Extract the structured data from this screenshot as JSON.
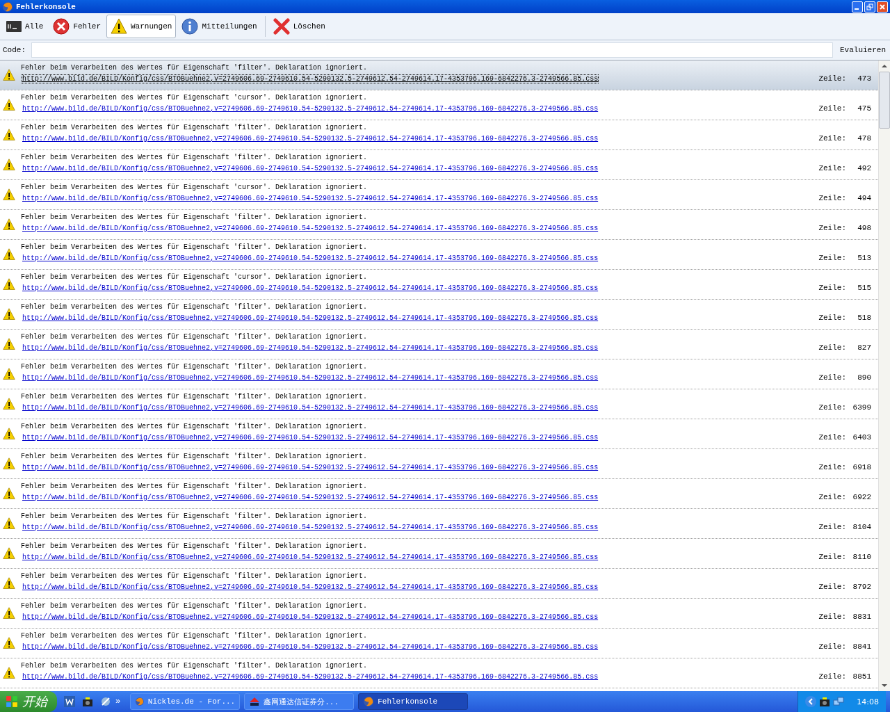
{
  "window": {
    "title": "Fehlerkonsole"
  },
  "toolbar": [
    {
      "label": "Alle",
      "kind": "console",
      "selected": false
    },
    {
      "label": "Fehler",
      "kind": "error",
      "selected": false
    },
    {
      "label": "Warnungen",
      "kind": "warning",
      "selected": true
    },
    {
      "label": "Mitteilungen",
      "kind": "info",
      "selected": false
    },
    {
      "label": "Löschen",
      "kind": "clear",
      "selected": false
    }
  ],
  "code_bar": {
    "label": "Code:",
    "button": "Evaluieren"
  },
  "messages": [
    {
      "text": "Fehler beim Verarbeiten des Wertes für Eigenschaft 'filter'.  Deklaration ignoriert.",
      "url": "http://www.bild.de/BILD/Konfig/css/BTOBuehne2,v=2749606.69-2749610.54-5290132.5-2749612.54-2749614.17-4353796.169-6842276.3-2749566.85.css",
      "line_label": "Zeile:",
      "line": "473",
      "selected": true
    },
    {
      "text": "Fehler beim Verarbeiten des Wertes für Eigenschaft 'cursor'.  Deklaration ignoriert.",
      "url": "http://www.bild.de/BILD/Konfig/css/BTOBuehne2,v=2749606.69-2749610.54-5290132.5-2749612.54-2749614.17-4353796.169-6842276.3-2749566.85.css",
      "line_label": "Zeile:",
      "line": "475",
      "selected": false
    },
    {
      "text": "Fehler beim Verarbeiten des Wertes für Eigenschaft 'filter'.  Deklaration ignoriert.",
      "url": "http://www.bild.de/BILD/Konfig/css/BTOBuehne2,v=2749606.69-2749610.54-5290132.5-2749612.54-2749614.17-4353796.169-6842276.3-2749566.85.css",
      "line_label": "Zeile:",
      "line": "478",
      "selected": false
    },
    {
      "text": "Fehler beim Verarbeiten des Wertes für Eigenschaft 'filter'.  Deklaration ignoriert.",
      "url": "http://www.bild.de/BILD/Konfig/css/BTOBuehne2,v=2749606.69-2749610.54-5290132.5-2749612.54-2749614.17-4353796.169-6842276.3-2749566.85.css",
      "line_label": "Zeile:",
      "line": "492",
      "selected": false
    },
    {
      "text": "Fehler beim Verarbeiten des Wertes für Eigenschaft 'cursor'.  Deklaration ignoriert.",
      "url": "http://www.bild.de/BILD/Konfig/css/BTOBuehne2,v=2749606.69-2749610.54-5290132.5-2749612.54-2749614.17-4353796.169-6842276.3-2749566.85.css",
      "line_label": "Zeile:",
      "line": "494",
      "selected": false
    },
    {
      "text": "Fehler beim Verarbeiten des Wertes für Eigenschaft 'filter'.  Deklaration ignoriert.",
      "url": "http://www.bild.de/BILD/Konfig/css/BTOBuehne2,v=2749606.69-2749610.54-5290132.5-2749612.54-2749614.17-4353796.169-6842276.3-2749566.85.css",
      "line_label": "Zeile:",
      "line": "498",
      "selected": false
    },
    {
      "text": "Fehler beim Verarbeiten des Wertes für Eigenschaft 'filter'.  Deklaration ignoriert.",
      "url": "http://www.bild.de/BILD/Konfig/css/BTOBuehne2,v=2749606.69-2749610.54-5290132.5-2749612.54-2749614.17-4353796.169-6842276.3-2749566.85.css",
      "line_label": "Zeile:",
      "line": "513",
      "selected": false
    },
    {
      "text": "Fehler beim Verarbeiten des Wertes für Eigenschaft 'cursor'.  Deklaration ignoriert.",
      "url": "http://www.bild.de/BILD/Konfig/css/BTOBuehne2,v=2749606.69-2749610.54-5290132.5-2749612.54-2749614.17-4353796.169-6842276.3-2749566.85.css",
      "line_label": "Zeile:",
      "line": "515",
      "selected": false
    },
    {
      "text": "Fehler beim Verarbeiten des Wertes für Eigenschaft 'filter'.  Deklaration ignoriert.",
      "url": "http://www.bild.de/BILD/Konfig/css/BTOBuehne2,v=2749606.69-2749610.54-5290132.5-2749612.54-2749614.17-4353796.169-6842276.3-2749566.85.css",
      "line_label": "Zeile:",
      "line": "518",
      "selected": false
    },
    {
      "text": "Fehler beim Verarbeiten des Wertes für Eigenschaft 'filter'.  Deklaration ignoriert.",
      "url": "http://www.bild.de/BILD/Konfig/css/BTOBuehne2,v=2749606.69-2749610.54-5290132.5-2749612.54-2749614.17-4353796.169-6842276.3-2749566.85.css",
      "line_label": "Zeile:",
      "line": "827",
      "selected": false
    },
    {
      "text": "Fehler beim Verarbeiten des Wertes für Eigenschaft 'filter'.  Deklaration ignoriert.",
      "url": "http://www.bild.de/BILD/Konfig/css/BTOBuehne2,v=2749606.69-2749610.54-5290132.5-2749612.54-2749614.17-4353796.169-6842276.3-2749566.85.css",
      "line_label": "Zeile:",
      "line": "890",
      "selected": false
    },
    {
      "text": "Fehler beim Verarbeiten des Wertes für Eigenschaft 'filter'.  Deklaration ignoriert.",
      "url": "http://www.bild.de/BILD/Konfig/css/BTOBuehne2,v=2749606.69-2749610.54-5290132.5-2749612.54-2749614.17-4353796.169-6842276.3-2749566.85.css",
      "line_label": "Zeile:",
      "line": "6399",
      "selected": false
    },
    {
      "text": "Fehler beim Verarbeiten des Wertes für Eigenschaft 'filter'.  Deklaration ignoriert.",
      "url": "http://www.bild.de/BILD/Konfig/css/BTOBuehne2,v=2749606.69-2749610.54-5290132.5-2749612.54-2749614.17-4353796.169-6842276.3-2749566.85.css",
      "line_label": "Zeile:",
      "line": "6403",
      "selected": false
    },
    {
      "text": "Fehler beim Verarbeiten des Wertes für Eigenschaft 'filter'.  Deklaration ignoriert.",
      "url": "http://www.bild.de/BILD/Konfig/css/BTOBuehne2,v=2749606.69-2749610.54-5290132.5-2749612.54-2749614.17-4353796.169-6842276.3-2749566.85.css",
      "line_label": "Zeile:",
      "line": "6918",
      "selected": false
    },
    {
      "text": "Fehler beim Verarbeiten des Wertes für Eigenschaft 'filter'.  Deklaration ignoriert.",
      "url": "http://www.bild.de/BILD/Konfig/css/BTOBuehne2,v=2749606.69-2749610.54-5290132.5-2749612.54-2749614.17-4353796.169-6842276.3-2749566.85.css",
      "line_label": "Zeile:",
      "line": "6922",
      "selected": false
    },
    {
      "text": "Fehler beim Verarbeiten des Wertes für Eigenschaft 'filter'.  Deklaration ignoriert.",
      "url": "http://www.bild.de/BILD/Konfig/css/BTOBuehne2,v=2749606.69-2749610.54-5290132.5-2749612.54-2749614.17-4353796.169-6842276.3-2749566.85.css",
      "line_label": "Zeile:",
      "line": "8104",
      "selected": false
    },
    {
      "text": "Fehler beim Verarbeiten des Wertes für Eigenschaft 'filter'.  Deklaration ignoriert.",
      "url": "http://www.bild.de/BILD/Konfig/css/BTOBuehne2,v=2749606.69-2749610.54-5290132.5-2749612.54-2749614.17-4353796.169-6842276.3-2749566.85.css",
      "line_label": "Zeile:",
      "line": "8110",
      "selected": false
    },
    {
      "text": "Fehler beim Verarbeiten des Wertes für Eigenschaft 'filter'.  Deklaration ignoriert.",
      "url": "http://www.bild.de/BILD/Konfig/css/BTOBuehne2,v=2749606.69-2749610.54-5290132.5-2749612.54-2749614.17-4353796.169-6842276.3-2749566.85.css",
      "line_label": "Zeile:",
      "line": "8792",
      "selected": false
    },
    {
      "text": "Fehler beim Verarbeiten des Wertes für Eigenschaft 'filter'.  Deklaration ignoriert.",
      "url": "http://www.bild.de/BILD/Konfig/css/BTOBuehne2,v=2749606.69-2749610.54-5290132.5-2749612.54-2749614.17-4353796.169-6842276.3-2749566.85.css",
      "line_label": "Zeile:",
      "line": "8831",
      "selected": false
    },
    {
      "text": "Fehler beim Verarbeiten des Wertes für Eigenschaft 'filter'.  Deklaration ignoriert.",
      "url": "http://www.bild.de/BILD/Konfig/css/BTOBuehne2,v=2749606.69-2749610.54-5290132.5-2749612.54-2749614.17-4353796.169-6842276.3-2749566.85.css",
      "line_label": "Zeile:",
      "line": "8841",
      "selected": false
    },
    {
      "text": "Fehler beim Verarbeiten des Wertes für Eigenschaft 'filter'.  Deklaration ignoriert.",
      "url": "http://www.bild.de/BILD/Konfig/css/BTOBuehne2,v=2749606.69-2749610.54-5290132.5-2749612.54-2749614.17-4353796.169-6842276.3-2749566.85.css",
      "line_label": "Zeile:",
      "line": "8851",
      "selected": false
    }
  ],
  "taskbar": {
    "start": "开始",
    "more": "»",
    "tasks": [
      {
        "label": "Nickles.de - For...",
        "kind": "browser",
        "selected": false
      },
      {
        "label": "鑫网通达信证券分...",
        "kind": "stock",
        "selected": false
      },
      {
        "label": "Fehlerkonsole",
        "kind": "browser",
        "selected": true
      }
    ],
    "clock": "14:08"
  }
}
